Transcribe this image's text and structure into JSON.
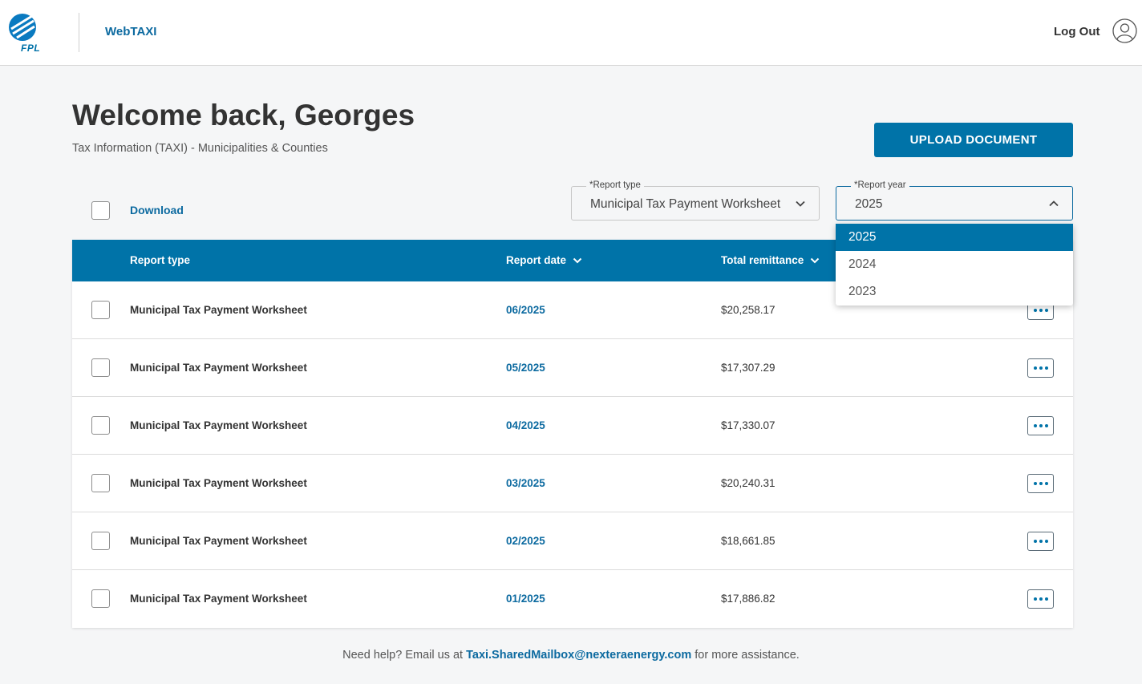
{
  "header": {
    "logo_text": "FPL",
    "app_name": "WebTAXI",
    "logout_label": "Log Out"
  },
  "welcome": {
    "title": "Welcome back, Georges",
    "subtitle": "Tax Information (TAXI) - Municipalities & Counties"
  },
  "upload_label": "UPLOAD DOCUMENT",
  "toolbar": {
    "download_label": "Download",
    "report_type": {
      "label": "*Report type",
      "value": "Municipal Tax Payment Worksheet"
    },
    "report_year": {
      "label": "*Report year",
      "value": "2025",
      "expanded": true,
      "options": [
        "2025",
        "2024",
        "2023"
      ],
      "selected": "2025"
    }
  },
  "table": {
    "columns": {
      "type": "Report type",
      "date": "Report date",
      "remittance": "Total remittance"
    },
    "rows": [
      {
        "type": "Municipal Tax Payment Worksheet",
        "date": "06/2025",
        "amount": "$20,258.17"
      },
      {
        "type": "Municipal Tax Payment Worksheet",
        "date": "05/2025",
        "amount": "$17,307.29"
      },
      {
        "type": "Municipal Tax Payment Worksheet",
        "date": "04/2025",
        "amount": "$17,330.07"
      },
      {
        "type": "Municipal Tax Payment Worksheet",
        "date": "03/2025",
        "amount": "$20,240.31"
      },
      {
        "type": "Municipal Tax Payment Worksheet",
        "date": "02/2025",
        "amount": "$18,661.85"
      },
      {
        "type": "Municipal Tax Payment Worksheet",
        "date": "01/2025",
        "amount": "$17,886.82"
      }
    ]
  },
  "footer": {
    "prefix": "Need help? Email us at",
    "email": "Taxi.SharedMailbox@nexteraenergy.com",
    "suffix": "for more assistance."
  },
  "colors": {
    "brand": "#0073a8",
    "link": "#0c6aa0"
  }
}
